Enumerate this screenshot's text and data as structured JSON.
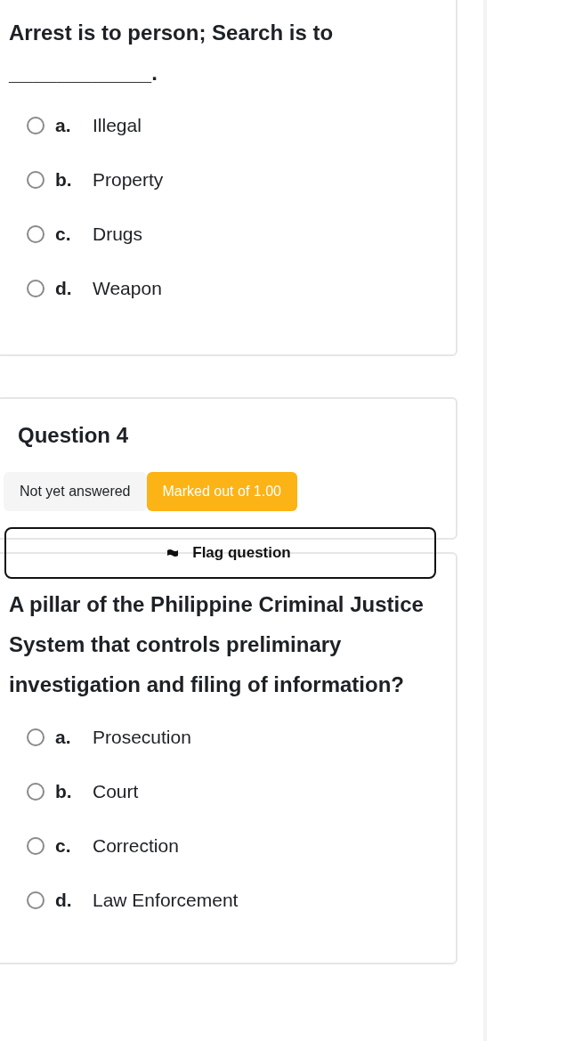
{
  "previous_question": {
    "text": "Arrest is to person; Search is to ____________.",
    "options": [
      {
        "letter": "a.",
        "label": "Illegal",
        "selected": false
      },
      {
        "letter": "b.",
        "label": "Property",
        "selected": false
      },
      {
        "letter": "c.",
        "label": "Drugs",
        "selected": false
      },
      {
        "letter": "d.",
        "label": "Weapon",
        "selected": false
      }
    ]
  },
  "question": {
    "title": "Question 4",
    "status": "Not yet answered",
    "marks": "Marked out of 1.00",
    "flag_button": "Flag question",
    "text": "A pillar of the Philippine Criminal Justice System that controls preliminary investigation and filing of information?",
    "options": [
      {
        "letter": "a.",
        "label": "Prosecution",
        "selected": false
      },
      {
        "letter": "b.",
        "label": "Court",
        "selected": false
      },
      {
        "letter": "c.",
        "label": "Correction",
        "selected": false
      },
      {
        "letter": "d.",
        "label": "Law Enforcement",
        "selected": false
      }
    ]
  }
}
